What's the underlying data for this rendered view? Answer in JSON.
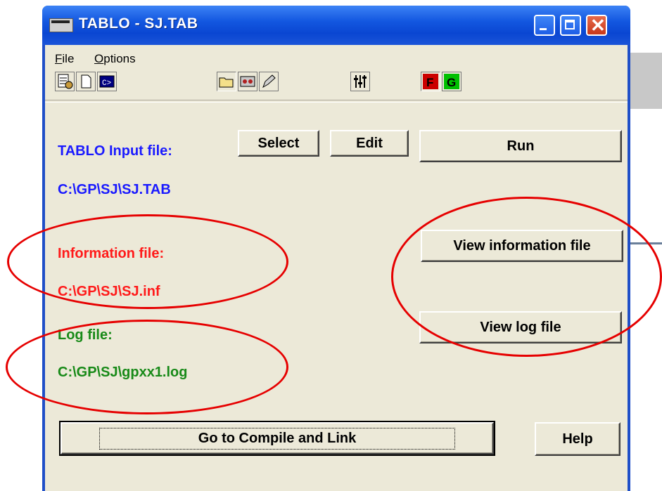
{
  "window": {
    "title": "TABLO - SJ.TAB"
  },
  "menu": {
    "file": "File",
    "options": "Options"
  },
  "toolbar": {
    "icons": [
      "wizard-icon",
      "new-file-icon",
      "command-prompt-icon",
      "open-folder-icon",
      "tape-icon",
      "pencil-icon",
      "sliders-icon",
      "fortran-icon",
      "gempack-icon"
    ]
  },
  "input": {
    "label": "TABLO Input file:",
    "path": "C:\\GP\\SJ\\SJ.TAB",
    "select": "Select",
    "edit": "Edit",
    "run": "Run"
  },
  "info": {
    "label": "Information file:",
    "path": "C:\\GP\\SJ\\SJ.inf",
    "view": "View information file"
  },
  "log": {
    "label": "Log file:",
    "path": "C:\\GP\\SJ\\gpxx1.log",
    "view": "View log file"
  },
  "footer": {
    "compile": "Go to Compile and Link",
    "help": "Help"
  },
  "colors": {
    "input_text": "#1a1aff",
    "info_text": "#ff1a1a",
    "log_text": "#188a18",
    "annotation": "#e60000"
  }
}
